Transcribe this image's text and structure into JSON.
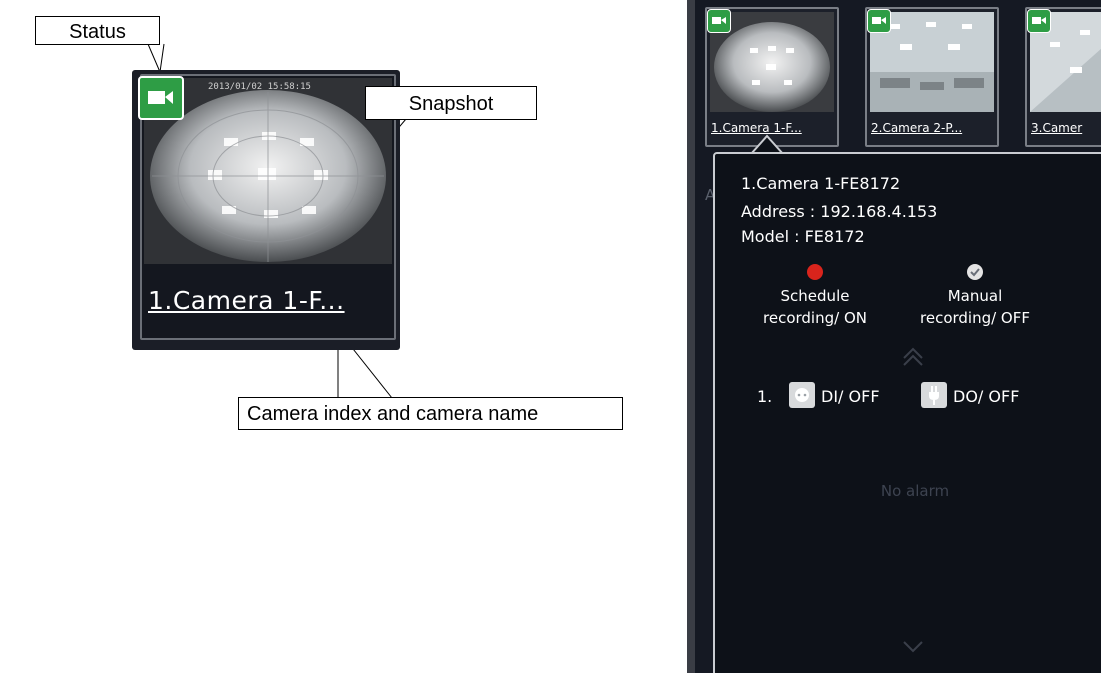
{
  "callouts": {
    "status": "Status",
    "snapshot": "Snapshot",
    "camera_index_name": "Camera index and camera name"
  },
  "big_thumbnail": {
    "caption": "1.Camera 1-F...",
    "timestamp": "2013/01/02 15:58:15",
    "status_icon": "video-camera-icon",
    "status_color": "#2e9d45"
  },
  "camera_strip": [
    {
      "caption": "1.Camera 1-F...",
      "status_icon": "video-camera-icon"
    },
    {
      "caption": "2.Camera 2-P...",
      "status_icon": "video-camera-icon"
    },
    {
      "caption": "3.Camer",
      "status_icon": "video-camera-icon"
    }
  ],
  "popup": {
    "camera_name": "1.Camera 1-FE8172",
    "address": "Address : 192.168.4.153",
    "model": "Model : FE8172",
    "schedule_recording": {
      "line1": "Schedule",
      "line2": "recording/ ON",
      "indicator_color": "#d9241c"
    },
    "manual_recording": {
      "line1": "Manual",
      "line2": "recording/ OFF",
      "indicator_color": "#e4e4e4"
    },
    "io_index": "1.",
    "di_label": "DI/ OFF",
    "do_label": "DO/ OFF",
    "empty_message": "No alarm"
  },
  "background_panel": {
    "alarm_label": "Alarm"
  }
}
